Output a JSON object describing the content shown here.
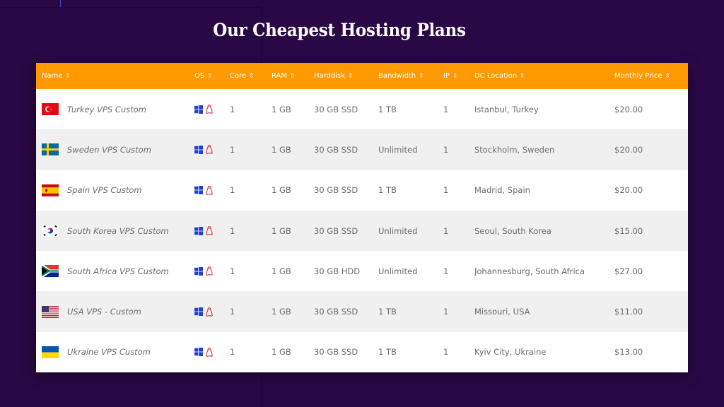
{
  "page": {
    "title": "Our Cheapest Hosting Plans"
  },
  "table": {
    "sort_glyph": "⇳",
    "headers": {
      "name": "Name",
      "os": "OS",
      "core": "Core",
      "ram": "RAM",
      "disk": "Harddisk",
      "bandwidth": "Bandwidth",
      "ip": "IP",
      "location": "DC Location",
      "price": "Monthly Price"
    },
    "rows": [
      {
        "flag": "turkey-flag-icon",
        "name": "Turkey VPS Custom",
        "core": "1",
        "ram": "1 GB",
        "disk": "30 GB SSD",
        "bandwidth": "1 TB",
        "ip": "1",
        "location": "Istanbul, Turkey",
        "price": "$20.00"
      },
      {
        "flag": "sweden-flag-icon",
        "name": "Sweden VPS Custom",
        "core": "1",
        "ram": "1 GB",
        "disk": "30 GB SSD",
        "bandwidth": "Unlimited",
        "ip": "1",
        "location": "Stockholm, Sweden",
        "price": "$20.00"
      },
      {
        "flag": "spain-flag-icon",
        "name": "Spain VPS Custom",
        "core": "1",
        "ram": "1 GB",
        "disk": "30 GB SSD",
        "bandwidth": "1 TB",
        "ip": "1",
        "location": "Madrid, Spain",
        "price": "$20.00"
      },
      {
        "flag": "south-korea-flag-icon",
        "name": "South Korea VPS Custom",
        "core": "1",
        "ram": "1 GB",
        "disk": "30 GB SSD",
        "bandwidth": "Unlimited",
        "ip": "1",
        "location": "Seoul, South Korea",
        "price": "$15.00"
      },
      {
        "flag": "south-africa-flag-icon",
        "name": "South Africa VPS Custom",
        "core": "1",
        "ram": "1 GB",
        "disk": "30 GB HDD",
        "bandwidth": "Unlimited",
        "ip": "1",
        "location": "Johannesburg, South Africa",
        "price": "$27.00"
      },
      {
        "flag": "usa-flag-icon",
        "name": "USA VPS - Custom",
        "core": "1",
        "ram": "1 GB",
        "disk": "30 GB SSD",
        "bandwidth": "1 TB",
        "ip": "1",
        "location": "Missouri, USA",
        "price": "$11.00"
      },
      {
        "flag": "ukraine-flag-icon",
        "name": "Ukraine VPS Custom",
        "core": "1",
        "ram": "1 GB",
        "disk": "30 GB SSD",
        "bandwidth": "1 TB",
        "ip": "1",
        "location": "Kyiv City, Ukraine",
        "price": "$13.00"
      }
    ],
    "os_icons": [
      "windows-icon",
      "linux-icon"
    ]
  },
  "colors": {
    "background": "#2a0845",
    "header": "#ff9900",
    "row_alt": "#f0f0f0",
    "text": "#6b6b6b",
    "windows": "#1f3fd6",
    "linux": "#d6202a"
  }
}
